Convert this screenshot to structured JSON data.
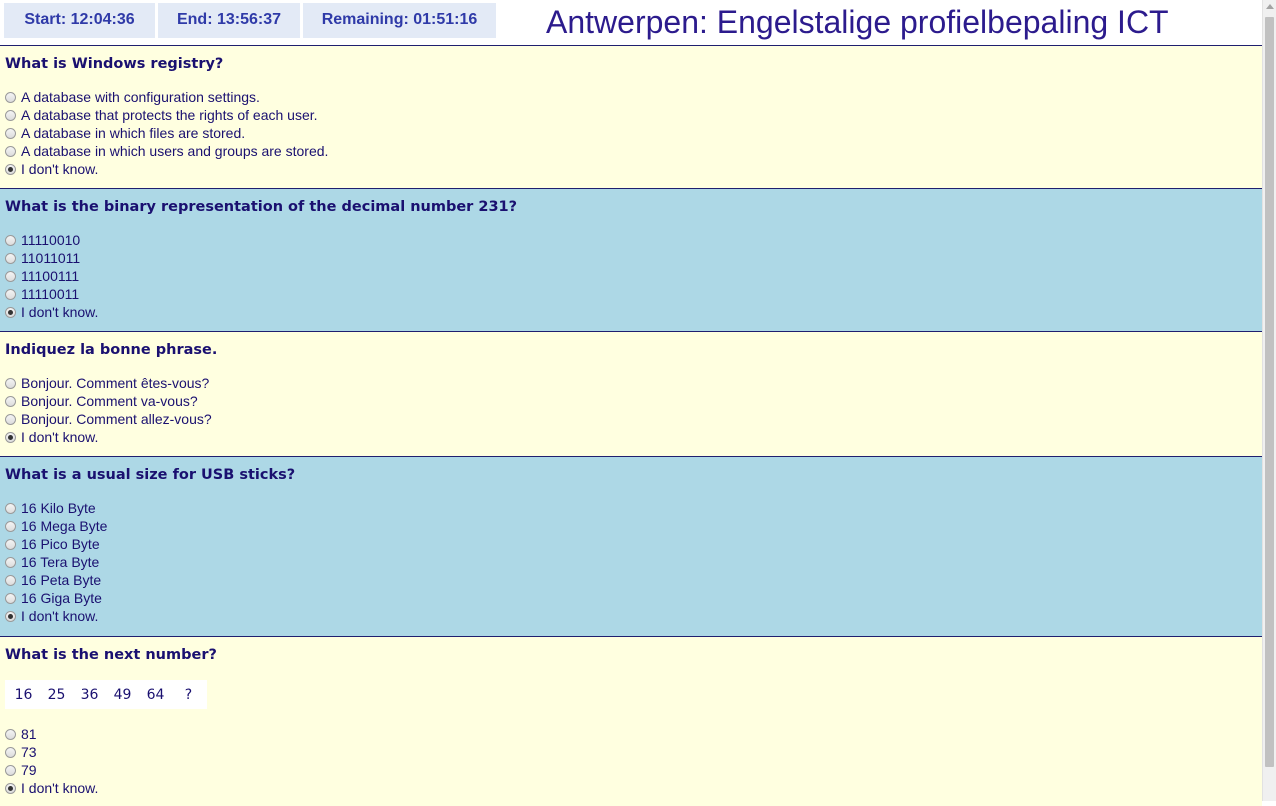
{
  "header": {
    "start": "Start: 12:04:36",
    "end": "End: 13:56:37",
    "remaining": "Remaining: 01:51:16",
    "title": "Antwerpen: Engelstalige profielbepaling ICT"
  },
  "questions": [
    {
      "text": "What is Windows registry?",
      "options": [
        {
          "label": "A database with configuration settings.",
          "selected": false
        },
        {
          "label": "A database that protects the rights of each user.",
          "selected": false
        },
        {
          "label": "A database in which files are stored.",
          "selected": false
        },
        {
          "label": "A database in which users and groups are stored.",
          "selected": false
        },
        {
          "label": "I don't know.",
          "selected": true
        }
      ]
    },
    {
      "text": "What is the binary representation of the decimal number 231?",
      "options": [
        {
          "label": "11110010",
          "selected": false
        },
        {
          "label": "11011011",
          "selected": false
        },
        {
          "label": "11100111",
          "selected": false
        },
        {
          "label": "11110011",
          "selected": false
        },
        {
          "label": "I don't know.",
          "selected": true
        }
      ]
    },
    {
      "text": "Indiquez la bonne phrase.",
      "options": [
        {
          "label": "Bonjour. Comment êtes-vous?",
          "selected": false
        },
        {
          "label": "Bonjour. Comment va-vous?",
          "selected": false
        },
        {
          "label": "Bonjour. Comment allez-vous?",
          "selected": false
        },
        {
          "label": "I don't know.",
          "selected": true
        }
      ]
    },
    {
      "text": "What is a usual size for USB sticks?",
      "options": [
        {
          "label": "16 Kilo Byte",
          "selected": false
        },
        {
          "label": "16 Mega Byte",
          "selected": false
        },
        {
          "label": "16 Pico Byte",
          "selected": false
        },
        {
          "label": "16 Tera Byte",
          "selected": false
        },
        {
          "label": "16 Peta Byte",
          "selected": false
        },
        {
          "label": "16 Giga Byte",
          "selected": false
        },
        {
          "label": "I don't know.",
          "selected": true
        }
      ]
    },
    {
      "text": "What is the next number?",
      "sequence": [
        "16",
        "25",
        "36",
        "49",
        "64",
        "?"
      ],
      "options": [
        {
          "label": "81",
          "selected": false
        },
        {
          "label": "73",
          "selected": false
        },
        {
          "label": "79",
          "selected": false
        },
        {
          "label": "I don't know.",
          "selected": true
        }
      ]
    }
  ]
}
